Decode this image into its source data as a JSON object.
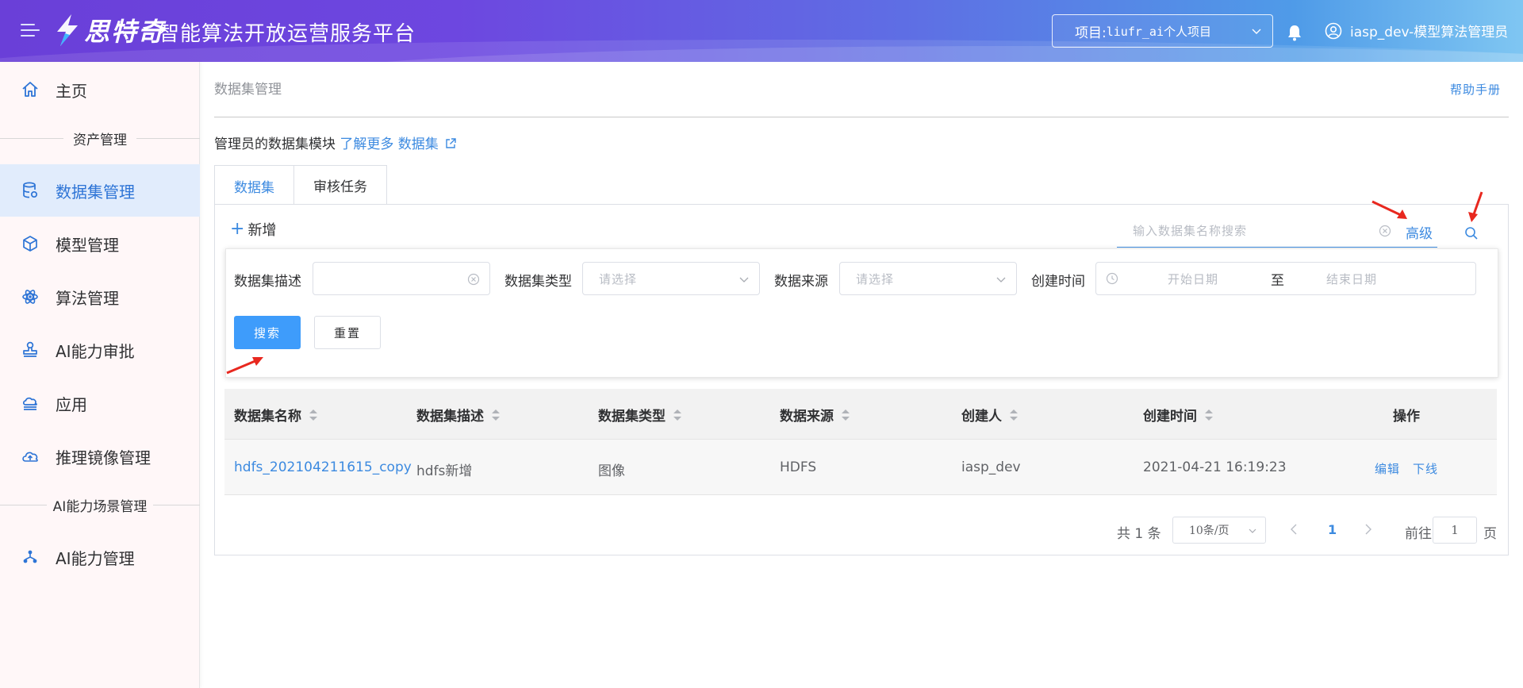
{
  "header": {
    "logo_text": "思特奇",
    "platform_title": "智能算法开放运营服务平台",
    "project_label": "项目:",
    "project_value": "liufr_ai个人项目",
    "user_name": "iasp_dev-模型算法管理员"
  },
  "sidebar": {
    "home": "主页",
    "section_assets": "资产管理",
    "items": [
      {
        "label": "数据集管理",
        "icon": "database-icon"
      },
      {
        "label": "模型管理",
        "icon": "cube-icon"
      },
      {
        "label": "算法管理",
        "icon": "atom-icon"
      },
      {
        "label": "AI能力审批",
        "icon": "stamp-icon"
      },
      {
        "label": "应用",
        "icon": "cloud-icon"
      },
      {
        "label": "推理镜像管理",
        "icon": "cloud-upload-icon"
      }
    ],
    "section_scenes": "AI能力场景管理",
    "scene_items": [
      {
        "label": "AI能力管理",
        "icon": "network-icon"
      }
    ]
  },
  "main": {
    "breadcrumb": "数据集管理",
    "help": "帮助手册",
    "intro_text": "管理员的数据集模块",
    "intro_link": "了解更多 数据集",
    "tabs": [
      {
        "label": "数据集"
      },
      {
        "label": "审核任务"
      }
    ],
    "add_label": "新增",
    "search_placeholder": "输入数据集名称搜索",
    "advanced_label": "高级",
    "filters": {
      "desc_label": "数据集描述",
      "type_label": "数据集类型",
      "type_placeholder": "请选择",
      "source_label": "数据来源",
      "source_placeholder": "请选择",
      "time_label": "创建时间",
      "start_placeholder": "开始日期",
      "range_sep": "至",
      "end_placeholder": "结束日期",
      "search_btn": "搜索",
      "reset_btn": "重置"
    },
    "table": {
      "columns": [
        "数据集名称",
        "数据集描述",
        "数据集类型",
        "数据来源",
        "创建人",
        "创建时间",
        "操作"
      ],
      "rows": [
        {
          "name": "hdfs_202104211615_copy",
          "desc": "hdfs新增",
          "type": "图像",
          "source": "HDFS",
          "creator": "iasp_dev",
          "created": "2021-04-21 16:19:23",
          "op_edit": "编辑",
          "op_offline": "下线"
        }
      ]
    },
    "pagination": {
      "total": "共 1 条",
      "page_size": "10条/页",
      "current": "1",
      "goto_label": "前往",
      "goto_value": "1",
      "page_unit": "页"
    }
  },
  "colors": {
    "accent": "#3c8ae0",
    "primary_button": "#3e9cfb",
    "sidebar_active_bg": "#e1ecfc",
    "annotation_arrow": "#e8281f"
  }
}
